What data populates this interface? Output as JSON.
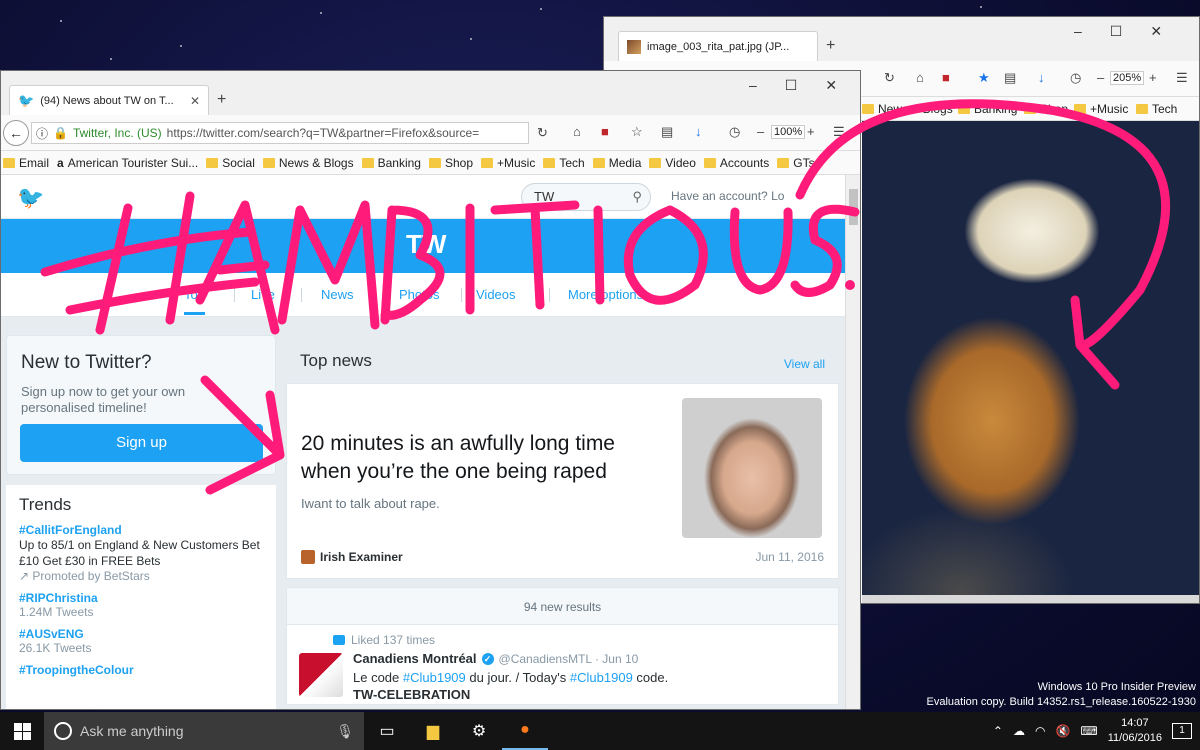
{
  "image_viewer": {
    "tab_title": "image_003_rita_pat.jpg (JP...",
    "zoom": "205%",
    "bookmarks": [
      "News & Blogs",
      "Banking",
      "Shop",
      "+Music",
      "Tech"
    ]
  },
  "firefox": {
    "tab_title": "(94) News about TW on T...",
    "site_identity": "Twitter, Inc. (US)",
    "url": "https://twitter.com/search?q=TW&partner=Firefox&source=",
    "zoom": "100%",
    "bookmarks": [
      "Email",
      "American Tourister Sui...",
      "Social",
      "News & Blogs",
      "Banking",
      "Shop",
      "+Music",
      "Tech",
      "Media",
      "Video",
      "Accounts",
      "GTs"
    ]
  },
  "twitter": {
    "search_value": "TW",
    "have_account": "Have an account? Lo",
    "banner_title": "TW",
    "nav": [
      "Top",
      "Live",
      "News",
      "Photos",
      "Videos",
      "More options"
    ],
    "new_to_twitter": {
      "title": "New to Twitter?",
      "text": "Sign up now to get your own personalised timeline!",
      "button": "Sign up"
    },
    "trends": {
      "title": "Trends",
      "items": [
        {
          "tag": "#CallitForEngland",
          "desc": "Up to 85/1 on England & New Customers Bet £10 Get £30 in FREE Bets",
          "meta": "Promoted by BetStars"
        },
        {
          "tag": "#RIPChristina",
          "meta": "1.24M Tweets"
        },
        {
          "tag": "#AUSvENG",
          "meta": "26.1K Tweets"
        },
        {
          "tag": "#TroopingtheColour"
        }
      ]
    },
    "top_news": {
      "title": "Top news",
      "view_all": "View all",
      "headline": "20 minutes is an awfully long time when you’re the one being raped",
      "subtitle": "Iwant to talk about rape.",
      "source": "Irish Examiner",
      "date": "Jun 11, 2016"
    },
    "new_results": "94 new results",
    "tweet": {
      "liked": "Liked 137 times",
      "name": "Canadiens Montréal",
      "handle": "@CanadiensMTL · Jun 10",
      "text_pre": "Le code ",
      "hashtag1": "#Club1909",
      "text_mid": " du jour. / Today's ",
      "hashtag2": "#Club1909",
      "text_post": " code.",
      "line2": "TW-CELEBRATION"
    }
  },
  "overlay_text": "#AMBITIOUS",
  "overlay_color": "#ff1b7a",
  "watermark": {
    "line1": "Windows 10 Pro Insider Preview",
    "line2": "Evaluation copy. Build 14352.rs1_release.160522-1930"
  },
  "taskbar": {
    "search_placeholder": "Ask me anything",
    "time": "14:07",
    "date": "11/06/2016",
    "notification_count": "1"
  }
}
